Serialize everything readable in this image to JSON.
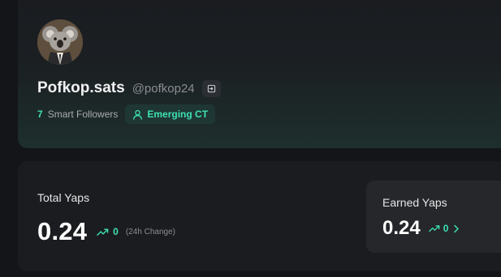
{
  "profile": {
    "display_name": "Pofkop.sats",
    "handle": "@pofkop24",
    "smart_followers_count": "7",
    "smart_followers_label": "Smart Followers",
    "tag_label": "Emerging CT",
    "avatar_icon": "koala-avatar",
    "copy_icon": "login-icon"
  },
  "stats": {
    "total_label": "Total Yaps",
    "total_value": "0.24",
    "change_value": "0",
    "change_note": "(24h Change)",
    "earned_label": "Earned Yaps",
    "earned_value": "0.24",
    "earned_change": "0"
  },
  "colors": {
    "accent": "#3ee0b3",
    "background": "#141518",
    "card": "#1b1c20"
  }
}
